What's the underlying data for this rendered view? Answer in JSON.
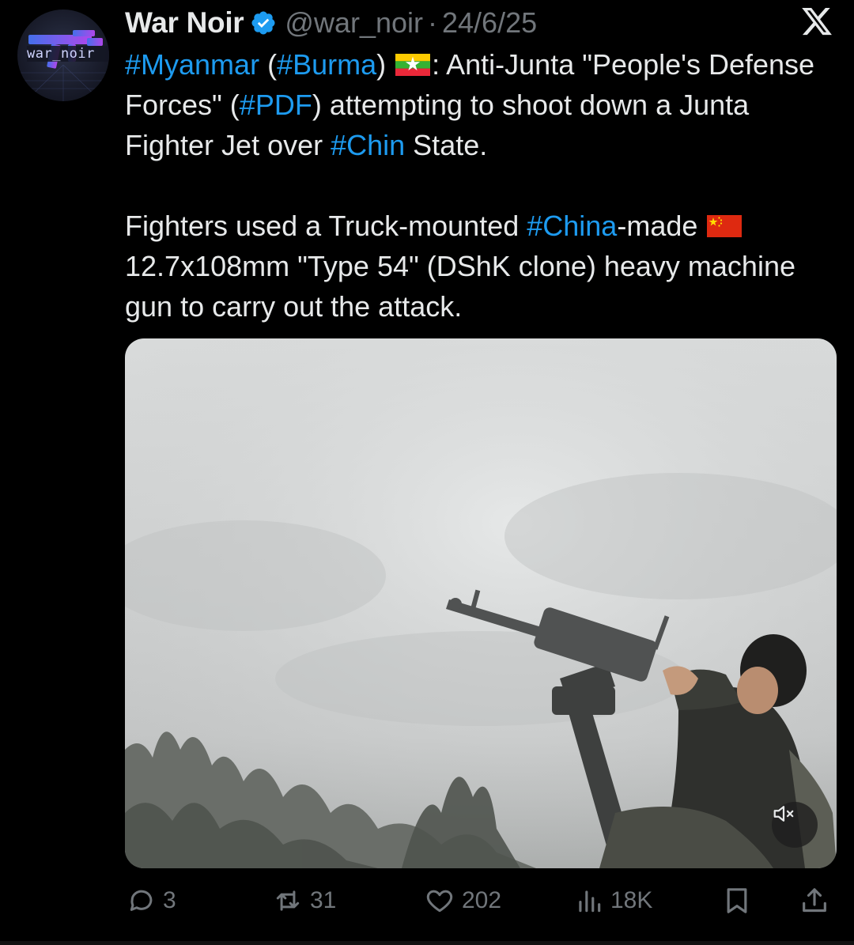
{
  "author": {
    "name": "War Noir",
    "handle": "@war_noir",
    "separator": "·",
    "date": "24/6/25",
    "avatar_text": "war_noir",
    "verified": true,
    "verified_color": "#1d9bf0"
  },
  "tweet": {
    "line1_tag1": "#Myanmar",
    "line1_open": " (",
    "line1_tag2": "#Burma",
    "line1_close": ") ",
    "line1_after_flag": ": Anti-Junta \"People's Defense Forces\" (",
    "line1_tag3": "#PDF",
    "line1_mid": ") attempting to shoot down a Junta Fighter Jet over ",
    "line1_tag4": "#Chin",
    "line1_end": " State.",
    "line2_start": "Fighters used a Truck-mounted ",
    "line2_tag": "#China",
    "line2_after_tag": "-made ",
    "line2_end": " 12.7x108mm \"Type 54\" (DShK clone)  heavy machine gun to carry out the attack.",
    "flag1": "myanmar-flag",
    "flag2": "china-flag",
    "hashtag_color": "#1d9bf0"
  },
  "media": {
    "type": "video",
    "muted": true
  },
  "actions": {
    "replies": "3",
    "reposts": "31",
    "likes": "202",
    "views": "18K"
  },
  "icons": {
    "logo": "x-logo-icon",
    "reply": "reply-icon",
    "repost": "repost-icon",
    "like": "heart-icon",
    "views": "views-icon",
    "bookmark": "bookmark-icon",
    "share": "share-icon",
    "mute": "speaker-muted-icon"
  }
}
